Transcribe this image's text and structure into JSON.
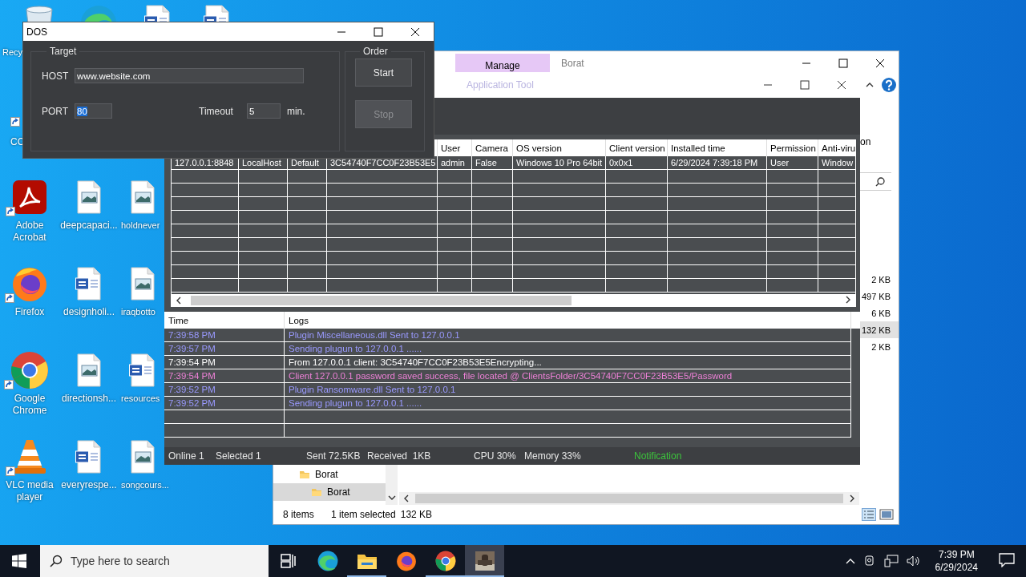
{
  "desktop": {
    "top_icons": [
      {
        "kind": "recycle-bin",
        "label": "Recy"
      },
      {
        "kind": "edge"
      },
      {
        "kind": "word"
      },
      {
        "kind": "word"
      }
    ],
    "side_icon": {
      "label": "CC",
      "shortcut": true
    },
    "icons": [
      {
        "kind": "acrobat",
        "label": "Adobe Acrobat",
        "shortcut": true
      },
      {
        "kind": "image",
        "label": "deepcapaci...",
        "shortcut": false
      },
      {
        "kind": "image",
        "label": "holdnever",
        "shortcut": false
      },
      {
        "kind": "firefox",
        "label": "Firefox",
        "shortcut": true
      },
      {
        "kind": "word",
        "label": "designholi...",
        "shortcut": false
      },
      {
        "kind": "image",
        "label": "iraqbotto",
        "shortcut": false
      },
      {
        "kind": "chrome",
        "label": "Google Chrome",
        "shortcut": true
      },
      {
        "kind": "image",
        "label": "directionsh...",
        "shortcut": false
      },
      {
        "kind": "word",
        "label": "resources",
        "shortcut": false
      },
      {
        "kind": "vlc",
        "label": "VLC media player",
        "shortcut": true
      },
      {
        "kind": "word",
        "label": "everyrespe...",
        "shortcut": false
      },
      {
        "kind": "image",
        "label": "songcours...",
        "shortcut": false
      }
    ]
  },
  "explorer": {
    "context_tab": "Manage",
    "title": "Borat",
    "ribbon_text": "on",
    "sizes": [
      {
        "label": "2 KB",
        "selected": false
      },
      {
        "label": "497 KB",
        "selected": false
      },
      {
        "label": "6 KB",
        "selected": false
      },
      {
        "label": "132 KB",
        "selected": true
      },
      {
        "label": "2 KB",
        "selected": false
      }
    ],
    "nav": [
      {
        "label": "Borat",
        "selected": false,
        "children": [
          {
            "label": "Borat",
            "selected": true
          }
        ]
      }
    ],
    "status": {
      "items": "8 items",
      "selection": "1 item selected",
      "size": "132 KB"
    }
  },
  "client": {
    "title": "Application Tool",
    "clients": {
      "columns": [
        "",
        "",
        "",
        "",
        "User",
        "Camera",
        "OS version",
        "Client version",
        "Installed time",
        "Permission",
        "Anti-viru"
      ],
      "rows": [
        {
          "cells": [
            "127.0.0.1:8848",
            "LocalHost",
            "Default",
            "3C54740F7CC0F23B53E5",
            "admin",
            "False",
            "Windows 10 Pro 64bit",
            "0x0x1",
            "6/29/2024 7:39:18 PM",
            "User",
            "Window"
          ]
        }
      ]
    },
    "logs": {
      "columns": [
        "Time",
        "Logs"
      ],
      "entries": [
        {
          "time": "7:39:58 PM",
          "message": "Plugin Miscellaneous.dll Sent to 127.0.0.1",
          "color": "#9a9aff"
        },
        {
          "time": "7:39:57 PM",
          "message": "Sending plugun to 127.0.0.1 ......",
          "color": "#9a9aff"
        },
        {
          "time": "7:39:54 PM",
          "message": "From 127.0.0.1 client: 3C54740F7CC0F23B53E5Encrypting...",
          "color": "#ffffff"
        },
        {
          "time": "7:39:54 PM",
          "message": "Client 127.0.0.1 password saved success, file located @ ClientsFolder/3C54740F7CC0F23B53E5/Password",
          "color": "#ec80d6"
        },
        {
          "time": "7:39:52 PM",
          "message": "Plugin Ransomware.dll Sent to 127.0.0.1",
          "color": "#9a9aff"
        },
        {
          "time": "7:39:52 PM",
          "message": "Sending plugun to 127.0.0.1 ......",
          "color": "#9a9aff"
        }
      ]
    },
    "status": {
      "online": "Online 1",
      "selected": "Selected 1",
      "sent": "Sent 72.5KB",
      "received": "Received  1KB",
      "cpu": "CPU 30%",
      "memory": "Memory 33%",
      "notification": {
        "text": "Notification",
        "color": "#3cc43c"
      }
    }
  },
  "dos": {
    "title": "DOS",
    "target_group": "Target",
    "host": {
      "label": "HOST",
      "value": "www.website.com"
    },
    "port": {
      "label": "PORT",
      "value": "80",
      "text_selected": true
    },
    "timeout": {
      "label": "Timeout",
      "value": "5",
      "unit": "min."
    },
    "order_group": "Order",
    "buttons": [
      {
        "label": "Start",
        "disabled": false
      },
      {
        "label": "Stop",
        "disabled": true
      }
    ]
  },
  "taskbar": {
    "search": {
      "placeholder": "Type here to search"
    },
    "apps": [
      {
        "kind": "task-view",
        "running": false,
        "selected": false
      },
      {
        "kind": "edge",
        "running": false,
        "selected": false
      },
      {
        "kind": "explorer",
        "running": true,
        "selected": false
      },
      {
        "kind": "firefox",
        "running": false,
        "selected": false
      },
      {
        "kind": "chrome",
        "running": true,
        "selected": false
      },
      {
        "kind": "app",
        "running": true,
        "selected": true
      }
    ],
    "clock": {
      "time": "7:39 PM",
      "date": "6/29/2024"
    }
  }
}
